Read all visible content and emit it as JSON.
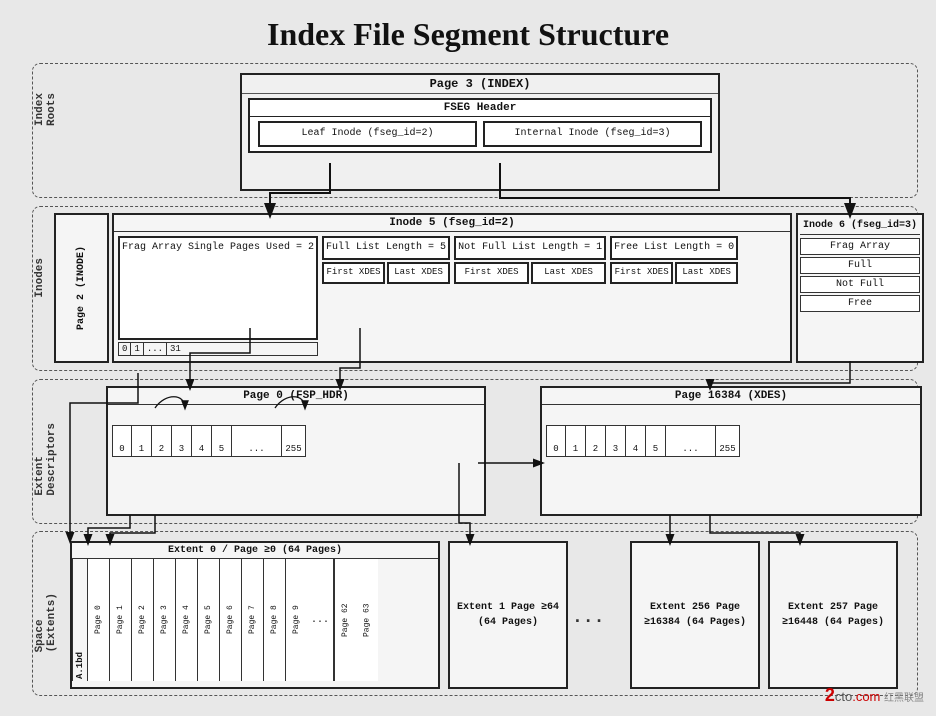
{
  "title": "Index File Segment Structure",
  "sections": {
    "index_roots": {
      "label": "Index\nRoots"
    },
    "inodes": {
      "label": "Inodes"
    },
    "extent_descriptors": {
      "label": "Extent\nDescriptors"
    },
    "space": {
      "label": "Space\n(Extents)"
    }
  },
  "page3": {
    "title": "Page 3 (INDEX)",
    "fseg_header": "FSEG Header",
    "leaf_inode": "Leaf Inode\n(fseg_id=2)",
    "internal_inode": "Internal Inode\n(fseg_id=3)"
  },
  "inode5": {
    "title": "Inode 5 (fseg_id=2)",
    "frag_array": "Frag Array\nSingle Pages\nUsed = 2",
    "frag_cells": [
      "0",
      "1",
      "...",
      "31"
    ],
    "full_list": "Full List\nLength = 5",
    "full_first": "First\nXDES",
    "full_last": "Last\nXDES",
    "notfull_list": "Not Full List\nLength = 1",
    "notfull_first": "First\nXDES",
    "notfull_last": "Last\nXDES",
    "free_list": "Free List\nLength = 0",
    "free_first": "First\nXDES",
    "free_last": "Last\nXDES"
  },
  "inode6": {
    "title": "Inode 6\n(fseg_id=3)",
    "frag_array": "Frag Array",
    "full": "Full",
    "not_full": "Not Full",
    "free": "Free"
  },
  "page2": {
    "label": "Page 2 (INODE)"
  },
  "page0": {
    "title": "Page 0 (FSP_HDR)",
    "cells": [
      "0",
      "1",
      "2",
      "3",
      "4",
      "5",
      "...",
      "255"
    ]
  },
  "page16384": {
    "title": "Page 16384 (XDES)",
    "cells": [
      "0",
      "1",
      "2",
      "3",
      "4",
      "5",
      "...",
      "255"
    ]
  },
  "extents": {
    "extent0": {
      "title": "Extent 0 / Page ≥0 (64 Pages)",
      "pages": [
        "Page 0",
        "Page 1",
        "Page 2",
        "Page 3",
        "Page 4",
        "Page 5",
        "Page 6",
        "Page 7",
        "Page 8",
        "Page 9"
      ],
      "dots": "...",
      "page62": "Page 62",
      "page63": "Page 63",
      "label": "A.1bd"
    },
    "extent1": {
      "title": "Extent 1\nPage ≥64\n(64 Pages)"
    },
    "extent256": {
      "title": "Extent 256\nPage ≥16384\n(64 Pages)"
    },
    "extent257": {
      "title": "Extent 257\nPage ≥16448\n(64 Pages)"
    }
  },
  "watermark": "2cto红黑联盟.com"
}
